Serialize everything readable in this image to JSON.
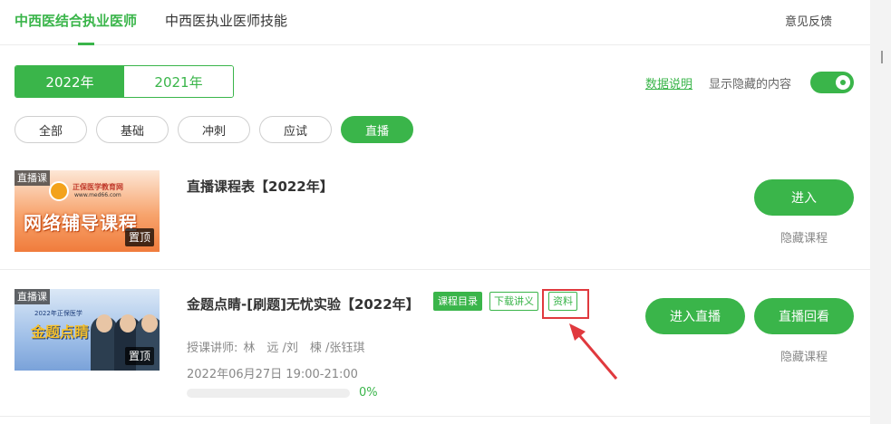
{
  "tabs": [
    {
      "label": "中西医结合执业医师",
      "active": true
    },
    {
      "label": "中西医执业医师技能",
      "active": false
    }
  ],
  "feedback": "意见反馈",
  "years": [
    {
      "label": "2022年",
      "active": true
    },
    {
      "label": "2021年",
      "active": false
    }
  ],
  "data_explain": "数据说明",
  "show_hidden": {
    "label": "显示隐藏的内容",
    "enabled": true
  },
  "filters": [
    {
      "label": "全部",
      "active": false
    },
    {
      "label": "基础",
      "active": false
    },
    {
      "label": "冲刺",
      "active": false
    },
    {
      "label": "应试",
      "active": false
    },
    {
      "label": "直播",
      "active": true
    }
  ],
  "courses": [
    {
      "badge": "直播课",
      "pinned": "置顶",
      "thumb_logo": "正保医学教育网",
      "thumb_url": "www.med66.com",
      "thumb_text": "网络辅导课程",
      "title": "直播课程表【2022年】",
      "enter": "进入",
      "hide": "隐藏课程"
    },
    {
      "badge": "直播课",
      "pinned": "置顶",
      "thumb_small": "2022年正保医学",
      "thumb_text": "金题点睛",
      "title": "金题点睛-[刷题]无忧实验【2022年】",
      "tags": [
        "课程目录",
        "下载讲义",
        "资料"
      ],
      "teachers_label": "授课讲师:",
      "teachers": "林　远 /刘　楝 /张钰琪",
      "datetime": "2022年06月27日 19:00-21:00",
      "progress_pct": "0%",
      "progress_fraction": 0,
      "live": "进入直播",
      "replay": "直播回看",
      "hide": "隐藏课程"
    }
  ],
  "colors": {
    "accent": "#3ab54a",
    "highlight": "#e0393e"
  }
}
